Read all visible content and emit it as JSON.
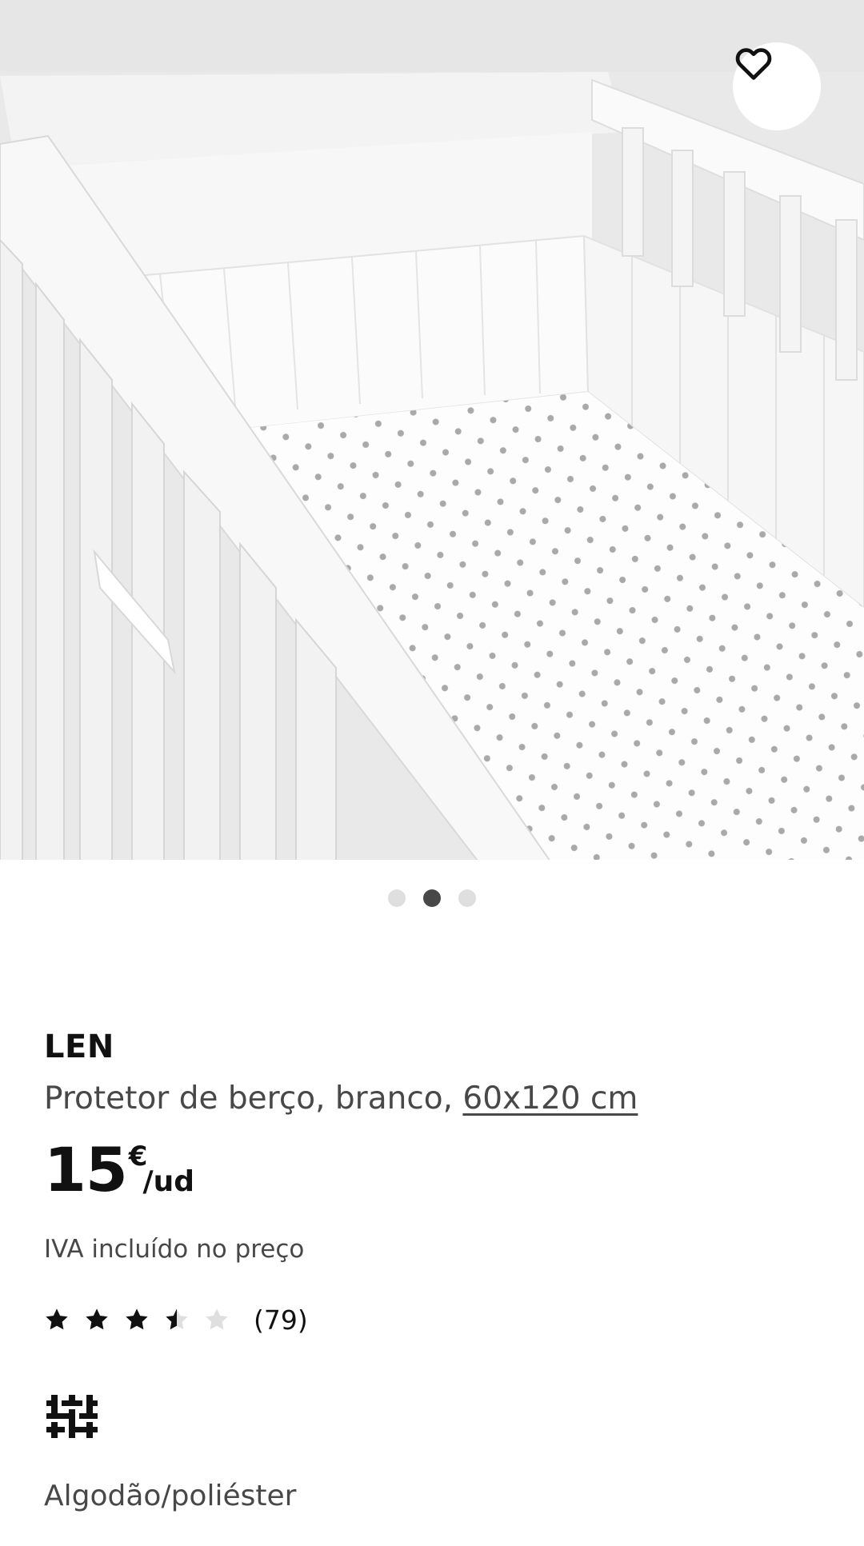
{
  "gallery": {
    "image_alt": "Protetor de berço branco num berço branco com lençol de pintas",
    "slides": 3,
    "active_slide_index": 1
  },
  "favourite": {
    "icon": "heart-outline-icon"
  },
  "product": {
    "name": "LEN",
    "description": "Protetor de berço, branco, ",
    "size": "60x120 cm",
    "price": {
      "amount": "15",
      "currency": "€",
      "unit": "/ud"
    },
    "vat_note": "IVA incluído no preço",
    "rating": {
      "value": 3.5,
      "max": 5,
      "count_text": "(79)"
    },
    "material": {
      "icon": "woven-fabric-icon",
      "label": "Algodão/poliéster"
    }
  },
  "colors": {
    "text": "#111111",
    "muted": "#484848",
    "dot_active": "#484848",
    "dot_inactive": "#dfdfdf",
    "star_filled": "#111111",
    "star_empty": "#dfdfdf"
  }
}
